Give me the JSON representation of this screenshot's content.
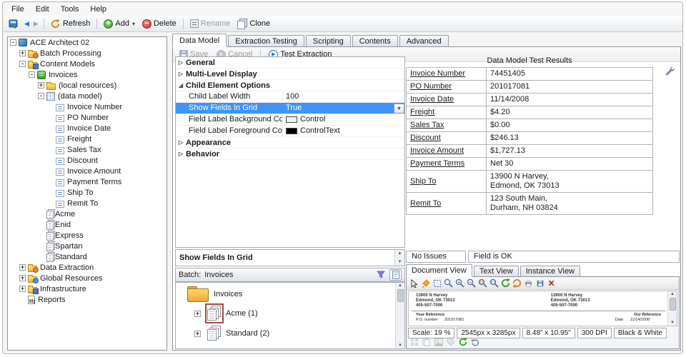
{
  "menubar": {
    "items": [
      "File",
      "Edit",
      "Tools",
      "Help"
    ]
  },
  "toolbar": {
    "refresh_label": "Refresh",
    "add_label": "Add",
    "delete_label": "Delete",
    "rename_label": "Rename",
    "clone_label": "Clone"
  },
  "tree": {
    "items": [
      {
        "label": "ACE Architect 02",
        "depth": 0,
        "expand": "minus",
        "icon": "server-icon"
      },
      {
        "label": "Batch Processing",
        "depth": 1,
        "expand": "plus",
        "icon": "folder-gear-icon"
      },
      {
        "label": "Content Models",
        "depth": 1,
        "expand": "minus",
        "icon": "folder-model-icon"
      },
      {
        "label": "Invoices",
        "depth": 2,
        "expand": "minus",
        "icon": "content-model-icon"
      },
      {
        "label": "(local resources)",
        "depth": 3,
        "expand": "plus",
        "icon": "folder-icon"
      },
      {
        "label": "(data model)",
        "depth": 3,
        "expand": "minus",
        "icon": "data-model-icon"
      },
      {
        "label": "Invoice Number",
        "depth": 4,
        "expand": null,
        "icon": "field-icon"
      },
      {
        "label": "PO Number",
        "depth": 4,
        "expand": null,
        "icon": "field-icon"
      },
      {
        "label": "Invoice Date",
        "depth": 4,
        "expand": null,
        "icon": "field-icon"
      },
      {
        "label": "Freight",
        "depth": 4,
        "expand": null,
        "icon": "field-icon"
      },
      {
        "label": "Sales Tax",
        "depth": 4,
        "expand": null,
        "icon": "field-icon"
      },
      {
        "label": "Discount",
        "depth": 4,
        "expand": null,
        "icon": "field-icon"
      },
      {
        "label": "Invoice Amount",
        "depth": 4,
        "expand": null,
        "icon": "field-icon"
      },
      {
        "label": "Payment Terms",
        "depth": 4,
        "expand": null,
        "icon": "field-icon"
      },
      {
        "label": "Ship To",
        "depth": 4,
        "expand": null,
        "icon": "field-icon"
      },
      {
        "label": "Remit To",
        "depth": 4,
        "expand": null,
        "icon": "field-icon"
      },
      {
        "label": "Acme",
        "depth": 3,
        "expand": null,
        "icon": "form-stack-icon"
      },
      {
        "label": "Enid",
        "depth": 3,
        "expand": null,
        "icon": "form-stack-icon"
      },
      {
        "label": "Express",
        "depth": 3,
        "expand": null,
        "icon": "form-stack-icon"
      },
      {
        "label": "Spartan",
        "depth": 3,
        "expand": null,
        "icon": "form-stack-icon"
      },
      {
        "label": "Standard",
        "depth": 3,
        "expand": null,
        "icon": "form-stack-icon"
      },
      {
        "label": "Data Extraction",
        "depth": 1,
        "expand": "plus",
        "icon": "folder-gear-icon"
      },
      {
        "label": "Global Resources",
        "depth": 1,
        "expand": "plus",
        "icon": "folder-globe-icon"
      },
      {
        "label": "Infrastructure",
        "depth": 1,
        "expand": "plus",
        "icon": "folder-model-icon"
      },
      {
        "label": "Reports",
        "depth": 1,
        "expand": null,
        "icon": "report-icon"
      }
    ]
  },
  "tabs": {
    "items": [
      {
        "label": "Data Model",
        "active": true
      },
      {
        "label": "Extraction Testing",
        "active": false
      },
      {
        "label": "Scripting",
        "active": false
      },
      {
        "label": "Contents",
        "active": false
      },
      {
        "label": "Advanced",
        "active": false
      }
    ]
  },
  "editor_toolbar": {
    "save_label": "Save",
    "cancel_label": "Cancel",
    "test_label": "Test Extraction"
  },
  "property_grid": {
    "rows": [
      {
        "type": "category",
        "label": "General",
        "state": "collapsed"
      },
      {
        "type": "category",
        "label": "Multi-Level Display",
        "state": "collapsed"
      },
      {
        "type": "category",
        "label": "Child Element Options",
        "state": "expanded"
      },
      {
        "type": "property",
        "name": "Child Label Width",
        "value": "100",
        "selected": false
      },
      {
        "type": "property",
        "name": "Show Fields In Grid",
        "value": "True",
        "selected": true,
        "combo": true
      },
      {
        "type": "property",
        "name": "Field Label Background Color",
        "value": "Control",
        "selected": false,
        "swatch": "#f0f0f0"
      },
      {
        "type": "property",
        "name": "Field Label Foreground Color",
        "value": "ControlText",
        "selected": false,
        "swatch": "#000000"
      },
      {
        "type": "category",
        "label": "Appearance",
        "state": "collapsed"
      },
      {
        "type": "category",
        "label": "Behavior",
        "state": "collapsed"
      }
    ]
  },
  "test_results": {
    "title": "Data Model Test Results",
    "rows": [
      {
        "field": "Invoice Number",
        "value": "74451405"
      },
      {
        "field": "PO Number",
        "value": "201017081"
      },
      {
        "field": "Invoice Date",
        "value": "11/14/2008"
      },
      {
        "field": "Freight",
        "value": "$4.20"
      },
      {
        "field": "Sales Tax",
        "value": "$0.00"
      },
      {
        "field": "Discount",
        "value": "$246.13"
      },
      {
        "field": "Invoice Amount",
        "value": "$1,727.13"
      },
      {
        "field": "Payment Terms",
        "value": "Net 30"
      },
      {
        "field": "Ship To",
        "value": "13900 N Harvey,\nEdmond, OK 73013"
      },
      {
        "field": "Remit To",
        "value": "123 South Main,\nDurham, NH 03824"
      }
    ]
  },
  "description_panel": {
    "text": "Show Fields In Grid"
  },
  "batch_panel": {
    "label": "Batch:",
    "value": "Invoices",
    "root_label": "Invoices",
    "items": [
      {
        "label": "Acme (1)",
        "selected": true
      },
      {
        "label": "Standard (2)",
        "selected": false
      }
    ]
  },
  "status_bar": {
    "left": "No Issues",
    "right": "Field is OK"
  },
  "viewer": {
    "tabs": [
      {
        "label": "Document View",
        "active": true
      },
      {
        "label": "Text View",
        "active": false
      },
      {
        "label": "Instance View",
        "active": false
      }
    ],
    "document": {
      "address_left": "13900 N Harvey\nEdmond, OK 73013\n405-507-7000",
      "address_right": "13900 N Harvey\nEdmond, OK 73013\n405-507-7000",
      "ref_left_label": "Your Reference",
      "ref_right_label": "Our Reference",
      "po_label": "P.O. number",
      "po_value": "201017081",
      "date_label": "Date",
      "date_value": "11/14/2008"
    },
    "status_segments": [
      "Scale: 19 %",
      "2545px x 3285px",
      "8.48\" x 10.95\"",
      "300 DPI",
      "Black & White"
    ]
  }
}
